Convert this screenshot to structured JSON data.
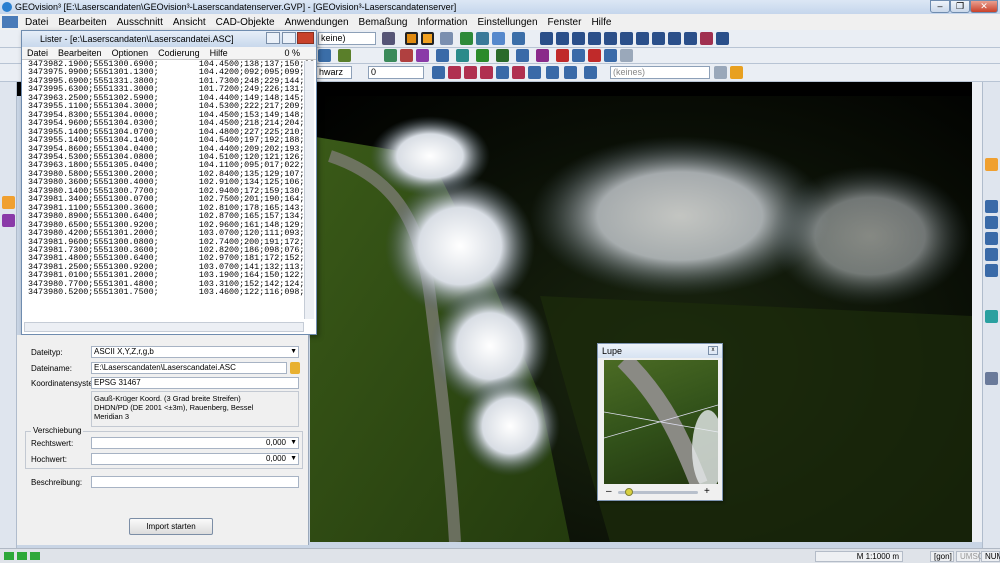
{
  "window": {
    "title": "GEOvision³ [E:\\Laserscandaten\\GEOvision³-Laserscandatenserver.GVP] - [GEOvision³-Laserscandatenserver]",
    "controls": [
      "–",
      "❐",
      "✕"
    ]
  },
  "menu": [
    "Datei",
    "Bearbeiten",
    "Ausschnitt",
    "Ansicht",
    "CAD-Objekte",
    "Anwendungen",
    "Bemaßung",
    "Information",
    "Einstellungen",
    "Fenster",
    "Hilfe"
  ],
  "toolbar": {
    "combo1": "keine)",
    "combo2": "hwarz",
    "combo3": "0",
    "combo4": "(keines)"
  },
  "lister": {
    "title": "Lister - [e:\\Laserscandaten\\Laserscandatei.ASC]",
    "menu": [
      "Datei",
      "Bearbeiten",
      "Optionen",
      "Codierung",
      "Hilfe"
    ],
    "percent": "0 %",
    "lines": [
      "3473982.1900;5551300.6900;        104.4500;138;137;150;02",
      "3473975.9900;5551301.1300;        104.4200;092;095;099;02",
      "3473995.6900;5551331.3800;        101.7300;248;229;144;05",
      "3473995.6300;5551331.3000;        101.7200;249;226;131;05",
      "3473963.2500;5551302.5900;        104.4400;149;148;145;02",
      "3473955.1100;5551304.3000;        104.5300;222;217;209;02",
      "3473954.8300;5551304.0000;        104.4500;153;149;148;02",
      "3473954.9600;5551304.0300;        104.4500;218;214;204;02",
      "3473955.1400;5551304.0700;        104.4800;227;225;210;02",
      "3473955.1400;5551304.1400;        104.5400;197;192;188;02",
      "3473954.8600;5551304.0400;        104.4400;209;202;193;02",
      "3473954.5300;5551304.0800;        104.5100;120;121;126;02",
      "3473963.1800;5551305.0400;        104.1100;095;017;022;02",
      "3473980.5800;5551300.2000;        102.8400;135;129;107;02",
      "3473980.3600;5551300.4000;        102.9100;134;125;106;02",
      "3473980.1400;5551300.7700;        102.9400;172;159;130;02",
      "3473981.3400;5551300.0700;        102.7500;201;190;164;02",
      "3473981.1100;5551300.3600;        102.8100;178;165;143;02",
      "3473980.8900;5551300.6400;        102.8700;165;157;134;02",
      "3473980.6500;5551300.9200;        102.9600;161;148;129;02",
      "3473980.4200;5551301.2000;        103.0700;120;111;093;02",
      "3473981.9600;5551300.0800;        102.7400;200;191;172;02",
      "3473981.7300;5551300.3600;        102.8200;186;098;076;02",
      "3473981.4800;5551300.6400;        102.9700;181;172;152;02",
      "3473981.2500;5551300.9200;        103.0700;141;132;113;02",
      "3473981.0100;5551301.2000;        103.1900;164;150;122;02",
      "3473980.7700;5551301.4800;        103.3100;152;142;124;02",
      "3473980.5200;5551301.7500;        103.4600;122;116;098;03"
    ]
  },
  "import": {
    "dateityp_label": "Dateityp:",
    "dateityp_value": "ASCII X,Y,Z,r,g,b",
    "dateiname_label": "Dateiname:",
    "dateiname_value": "E:\\Laserscandaten\\Laserscandatei.ASC",
    "koord_label": "Koordinatensystem:",
    "koord_value": "EPSG 31467",
    "koord_desc1": "Gauß-Krüger Koord. (3 Grad breite Streifen)",
    "koord_desc2": "DHDN/PD (DE 2001 <±3m), Rauenberg, Bessel",
    "koord_desc3": "Meridian 3",
    "verschiebung_label": "Verschiebung",
    "rechtswert_label": "Rechtswert:",
    "rechtswert_value": "0,000",
    "hochwert_label": "Hochwert:",
    "hochwert_value": "0,000",
    "beschreibung_label": "Beschreibung:",
    "button": "Import starten"
  },
  "lupe": {
    "title": "Lupe",
    "minus": "–",
    "plus": "+",
    "zoom_fraction": 0.1
  },
  "status": {
    "scale": "M 1:1000  m",
    "gon": "[gon]",
    "umsch": "UMSCH",
    "num": "NUM"
  }
}
